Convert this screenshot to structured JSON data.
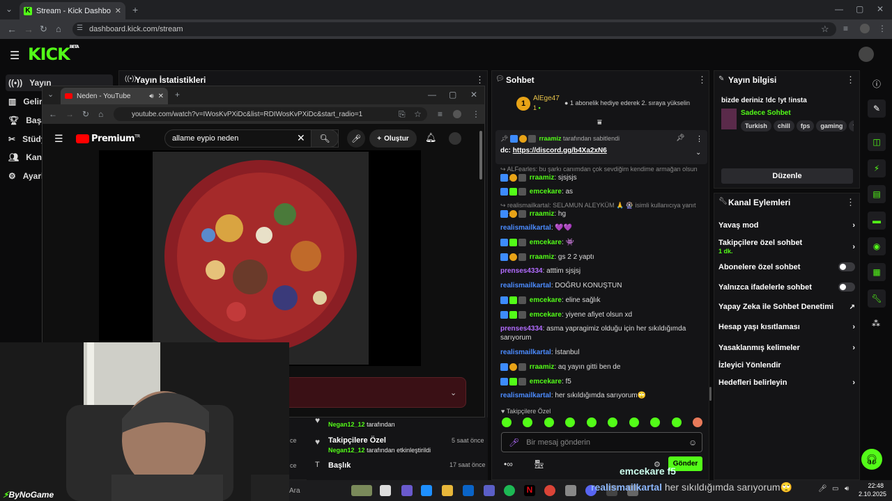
{
  "browser": {
    "tab_title": "Stream - Kick Dashboard",
    "url": "dashboard.kick.com/stream"
  },
  "kick": {
    "logo": "KICK",
    "logo_sup": "BETA",
    "sidebar": [
      {
        "label": "Yayın",
        "icon": "broadcast-icon"
      },
      {
        "label": "Gelir",
        "icon": "chart-icon"
      },
      {
        "label": "Başa",
        "icon": "trophy-icon"
      },
      {
        "label": "Stüdy",
        "icon": "tools-icon"
      },
      {
        "label": "Kana",
        "icon": "users-icon"
      },
      {
        "label": "Ayarl",
        "icon": "gear-icon"
      }
    ],
    "stats_panel_title": "Yayın İstatistikleri",
    "activity": [
      {
        "user": "Negan12_12",
        "text": "tarafından",
        "title": "",
        "time": ""
      },
      {
        "user": "Negan12_12",
        "text": "tarafından etkinleştirildi",
        "title": "Takipçilere Özel",
        "time": "5 saat önce"
      },
      {
        "user": "",
        "text": "",
        "title": "Başlık",
        "time": "17 saat önce"
      }
    ],
    "activity_left_times": [
      "ce",
      "ce"
    ]
  },
  "chat": {
    "title": "Sohbet",
    "top_gifter": {
      "name": "AlEge47",
      "count": "1",
      "message": "1 abonelik hediye ederek 2. sıraya yükselin"
    },
    "pinned": {
      "by": "rraamiz",
      "by_suffix": "tarafından sabitlendi",
      "prefix": "dc:",
      "link": "https://discord.gg/b4Xa2xN6"
    },
    "messages": [
      {
        "type": "reply",
        "text": "ALFearles: bu şarkı canımdan çok sevdiğim kendime armağan olsun is..."
      },
      {
        "type": "msg",
        "badges": [
          "mod",
          "sub",
          "og"
        ],
        "user": "rraamiz",
        "color": "green",
        "text": ": sjsjsjs"
      },
      {
        "type": "msg",
        "badges": [
          "mod",
          "vip",
          "og"
        ],
        "user": "emcekare",
        "color": "green",
        "text": ": as"
      },
      {
        "type": "reply",
        "text": "realismailkartal: SELAMUN ALEYKÜM 🙏 🎡 isimli kullanıcıya yanıt veri..."
      },
      {
        "type": "msg",
        "badges": [
          "mod",
          "sub",
          "og"
        ],
        "user": "rraamiz",
        "color": "green",
        "text": ": hg"
      },
      {
        "type": "msg",
        "badges": [],
        "user": "realismailkartal",
        "color": "blue",
        "text": ": 💜💜"
      },
      {
        "type": "msg",
        "badges": [
          "mod",
          "vip",
          "og"
        ],
        "user": "emcekare",
        "color": "green",
        "text": ": 👾"
      },
      {
        "type": "msg",
        "badges": [
          "mod",
          "sub",
          "og"
        ],
        "user": "rraamiz",
        "color": "green",
        "text": ": gs 2 2 yaptı"
      },
      {
        "type": "msg",
        "badges": [],
        "user": "prenses4334",
        "color": "purple",
        "text": ": atttim sjsjsj"
      },
      {
        "type": "msg",
        "badges": [],
        "user": "realismailkartal",
        "color": "blue",
        "text": ": DOĞRU KONUŞTUN"
      },
      {
        "type": "msg",
        "badges": [
          "mod",
          "vip",
          "og"
        ],
        "user": "emcekare",
        "color": "green",
        "text": ": eline sağlık"
      },
      {
        "type": "msg",
        "badges": [
          "mod",
          "vip",
          "og"
        ],
        "user": "emcekare",
        "color": "green",
        "text": ": yiyene afiyet olsun xd"
      },
      {
        "type": "msg",
        "badges": [],
        "user": "prenses4334",
        "color": "purple",
        "text": ": asma yapragimiz olduğu için her sıkıldığımda sarıyorum"
      },
      {
        "type": "msg",
        "badges": [],
        "user": "realismailkartal",
        "color": "blue",
        "text": ": İstanbul"
      },
      {
        "type": "msg",
        "badges": [
          "mod",
          "sub",
          "og"
        ],
        "user": "rraamiz",
        "color": "green",
        "text": ": aq yayın gitti ben de"
      },
      {
        "type": "msg",
        "badges": [
          "mod",
          "vip",
          "og"
        ],
        "user": "emcekare",
        "color": "green",
        "text": ": f5"
      },
      {
        "type": "msg",
        "badges": [],
        "user": "realismailkartal",
        "color": "blue",
        "text": ": her sıkıldığımda sarıyorum🙄"
      }
    ],
    "mode_label": "Takipçilere Özel",
    "input_placeholder": "Bir mesaj gönderin",
    "send_label": "Gönder"
  },
  "stream_info": {
    "title": "Yayın bilgisi",
    "stream_title": "bizde deriniz !dc !yt !insta",
    "category": "Sadece Sohbet",
    "tags": [
      "Turkish",
      "chill",
      "fps",
      "gaming",
      "fu"
    ],
    "edit_label": "Düzenle"
  },
  "channel_actions": {
    "title": "Kanal Eylemleri",
    "items": [
      {
        "label": "Yavaş mod",
        "sub": "",
        "control": "chevron"
      },
      {
        "label": "Takipçilere özel sohbet",
        "sub": "1 dk.",
        "control": "chevron"
      },
      {
        "label": "Abonelere özel sohbet",
        "sub": "",
        "control": "toggle"
      },
      {
        "label": "Yalnızca ifadelerle sohbet",
        "sub": "",
        "control": "toggle"
      },
      {
        "label": "Yapay Zeka ile Sohbet Denetimi",
        "sub": "",
        "control": "external"
      },
      {
        "label": "Hesap yaşı kısıtlaması",
        "sub": "",
        "control": "chevron"
      },
      {
        "label": "Yasaklanmış kelimeler",
        "sub": "",
        "control": "chevron"
      },
      {
        "label": "İzleyici Yönlendir",
        "sub": "",
        "control": "none"
      },
      {
        "label": "Hedefleri belirleyin",
        "sub": "",
        "control": "chevron"
      }
    ]
  },
  "youtube": {
    "tab_title": "Neden - YouTube",
    "url": "youtube.com/watch?v=IWosKvPXiDc&list=RDIWosKvPXiDc&start_radio=1",
    "brand": "Premium",
    "brand_sup": "TR",
    "search_value": "allame eypio neden",
    "create_label": "Oluştur"
  },
  "overlay": {
    "watermark": "ByNoGame",
    "chat_user": "emcekare",
    "chat_text": "f5",
    "chat_user2": "realismailkartal",
    "chat_text2": "her sıkıldığımda sarıyorum🙄"
  },
  "taskbar": {
    "search_placeholder": "Ara",
    "time": "22:48",
    "date": "2.10.2025"
  }
}
